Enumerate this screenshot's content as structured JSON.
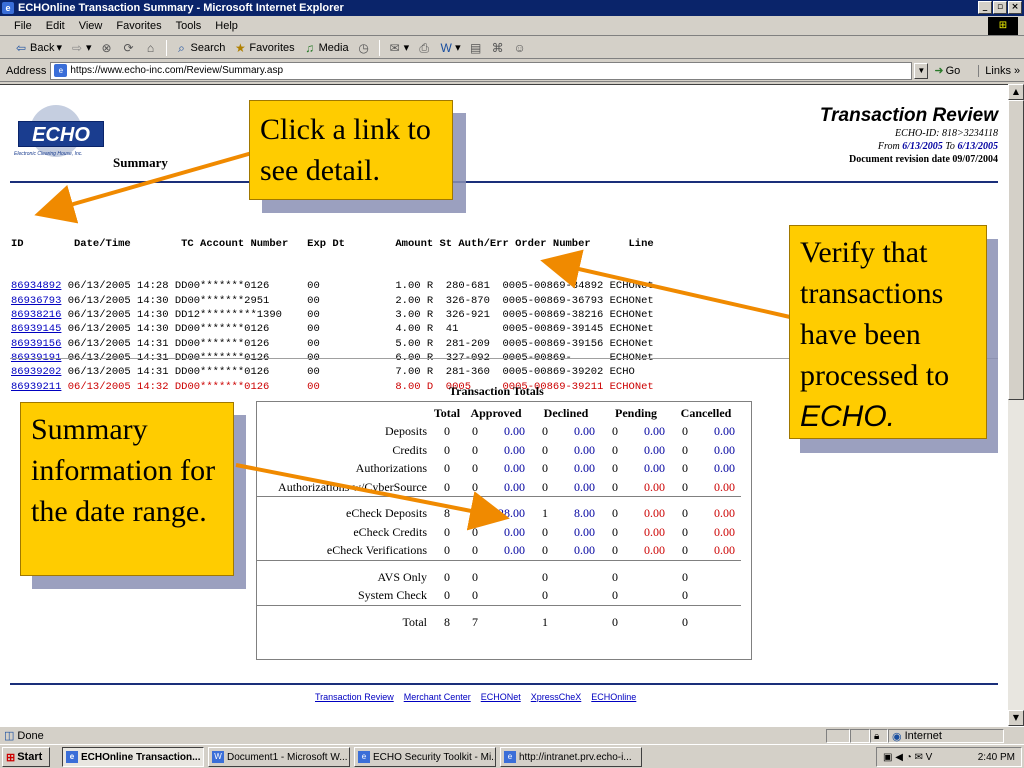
{
  "window": {
    "title": "ECHOnline Transaction Summary - Microsoft Internet Explorer"
  },
  "menu": [
    "File",
    "Edit",
    "View",
    "Favorites",
    "Tools",
    "Help"
  ],
  "toolbar": {
    "back": "Back",
    "search": "Search",
    "favorites": "Favorites",
    "media": "Media"
  },
  "address": {
    "label": "Address",
    "url": "https://www.echo-inc.com/Review/Summary.asp",
    "go": "Go",
    "links": "Links"
  },
  "header": {
    "logo_text": "ECHO",
    "logo_sub": "Electronic Clearing House, Inc.",
    "summary_label": "Summary",
    "title": "Transaction Review",
    "echo_id": "ECHO-ID: 818>3234118",
    "from_label": "From",
    "from_date": "6/13/2005",
    "to_label": "To",
    "to_date": "6/13/2005",
    "revision": "Document revision date 09/07/2004"
  },
  "transactions": {
    "header": "ID        Date/Time        TC Account Number   Exp Dt        Amount St Auth/Err Order Number      Line",
    "rows": [
      {
        "id": "86934892",
        "rest": " 06/13/2005 14:28 DD00*******0126      00            1.00 R  280-681  0005-00869-34892 ECHONet",
        "declined": false
      },
      {
        "id": "86936793",
        "rest": " 06/13/2005 14:30 DD00*******2951      00            2.00 R  326-870  0005-00869-36793 ECHONet",
        "declined": false
      },
      {
        "id": "86938216",
        "rest": " 06/13/2005 14:30 DD12*********1390    00            3.00 R  326-921  0005-00869-38216 ECHONet",
        "declined": false
      },
      {
        "id": "86939145",
        "rest": " 06/13/2005 14:30 DD00*******0126      00            4.00 R  41       0005-00869-39145 ECHONet",
        "declined": false
      },
      {
        "id": "86939156",
        "rest": " 06/13/2005 14:31 DD00*******0126      00            5.00 R  281-209  0005-00869-39156 ECHONet",
        "declined": false
      },
      {
        "id": "86939191",
        "rest": " 06/13/2005 14:31 DD00*******0126      00            6.00 R  327-092  0005-00869-      ECHONet",
        "declined": false
      },
      {
        "id": "86939202",
        "rest": " 06/13/2005 14:31 DD00*******0126      00            7.00 R  281-360  0005-00869-39202 ECHO",
        "declined": false
      },
      {
        "id": "86939211",
        "rest": " 06/13/2005 14:32 DD00*******0126      00            8.00 D  0005     0005-00869-39211 ECHONet",
        "declined": true
      }
    ]
  },
  "totals": {
    "title": "Transaction Totals",
    "headers": [
      "Total",
      "Approved",
      "Declined",
      "Pending",
      "Cancelled"
    ],
    "groups": [
      [
        {
          "label": "Deposits",
          "total": "0",
          "appr_n": "0",
          "appr_v": "0.00",
          "decl_n": "0",
          "decl_v": "0.00",
          "pend_n": "0",
          "pend_v": "0.00",
          "canc_n": "0",
          "canc_v": "0.00",
          "pend_red": false
        },
        {
          "label": "Credits",
          "total": "0",
          "appr_n": "0",
          "appr_v": "0.00",
          "decl_n": "0",
          "decl_v": "0.00",
          "pend_n": "0",
          "pend_v": "0.00",
          "canc_n": "0",
          "canc_v": "0.00",
          "pend_red": false
        },
        {
          "label": "Authorizations",
          "total": "0",
          "appr_n": "0",
          "appr_v": "0.00",
          "decl_n": "0",
          "decl_v": "0.00",
          "pend_n": "0",
          "pend_v": "0.00",
          "canc_n": "0",
          "canc_v": "0.00",
          "pend_red": false
        },
        {
          "label": "Authorizations w/CyberSource",
          "total": "0",
          "appr_n": "0",
          "appr_v": "0.00",
          "decl_n": "0",
          "decl_v": "0.00",
          "pend_n": "0",
          "pend_v": "0.00",
          "canc_n": "0",
          "canc_v": "0.00",
          "pend_red": true
        }
      ],
      [
        {
          "label": "eCheck Deposits",
          "total": "8",
          "appr_n": "7",
          "appr_v": "28.00",
          "decl_n": "1",
          "decl_v": "8.00",
          "pend_n": "0",
          "pend_v": "0.00",
          "canc_n": "0",
          "canc_v": "0.00",
          "pend_red": true
        },
        {
          "label": "eCheck Credits",
          "total": "0",
          "appr_n": "0",
          "appr_v": "0.00",
          "decl_n": "0",
          "decl_v": "0.00",
          "pend_n": "0",
          "pend_v": "0.00",
          "canc_n": "0",
          "canc_v": "0.00",
          "pend_red": true
        },
        {
          "label": "eCheck Verifications",
          "total": "0",
          "appr_n": "0",
          "appr_v": "0.00",
          "decl_n": "0",
          "decl_v": "0.00",
          "pend_n": "0",
          "pend_v": "0.00",
          "canc_n": "0",
          "canc_v": "0.00",
          "pend_red": true
        }
      ],
      [
        {
          "label": "AVS Only",
          "total": "0",
          "appr_n": "0",
          "appr_v": "",
          "decl_n": "0",
          "decl_v": "",
          "pend_n": "0",
          "pend_v": "",
          "canc_n": "0",
          "canc_v": "",
          "pend_red": false
        },
        {
          "label": "System Check",
          "total": "0",
          "appr_n": "0",
          "appr_v": "",
          "decl_n": "0",
          "decl_v": "",
          "pend_n": "0",
          "pend_v": "",
          "canc_n": "0",
          "canc_v": "",
          "pend_red": false
        }
      ],
      [
        {
          "label": "Total",
          "total": "8",
          "appr_n": "7",
          "appr_v": "",
          "decl_n": "1",
          "decl_v": "",
          "pend_n": "0",
          "pend_v": "",
          "canc_n": "0",
          "canc_v": "",
          "pend_red": false
        }
      ]
    ]
  },
  "footer_links": [
    "Transaction Review",
    "Merchant Center",
    "ECHONet",
    "XpressCheX",
    "ECHOnline"
  ],
  "callouts": {
    "detail": "Click a link to see detail.",
    "verify": "Verify that transactions have been processed to",
    "verify_em": "ECHO.",
    "summary": "Summary information for the date range."
  },
  "status": {
    "left": "Done",
    "zone": "Internet"
  },
  "taskbar": {
    "start": "Start",
    "tasks": [
      "ECHOnline Transaction...",
      "Document1 - Microsoft W...",
      "ECHO Security Toolkit - Mi...",
      "http://intranet.prv.echo-i..."
    ],
    "time": "2:40 PM"
  },
  "colors": {
    "accent": "#ffcc00",
    "link": "#0000c0",
    "declined": "#cc0000",
    "rule": "#1a2f7a"
  }
}
